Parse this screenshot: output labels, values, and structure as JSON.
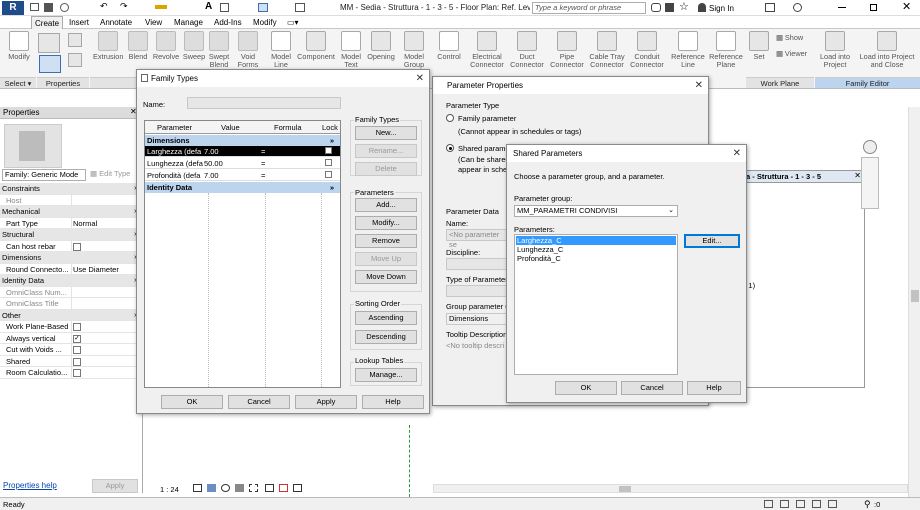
{
  "app": {
    "title": "MM - Sedia - Struttura - 1 - 3 - 5 - Floor Plan: Ref. Level",
    "search_placeholder": "Type a keyword or phrase",
    "sign_in": "Sign In",
    "logo_letter": "R"
  },
  "tabs": [
    "Create",
    "Insert",
    "Annotate",
    "View",
    "Manage",
    "Add-Ins",
    "Modify"
  ],
  "ribbon": {
    "buttons": [
      "Modify",
      "Extrusion",
      "Blend",
      "Revolve",
      "Sweep",
      "Swept Blend",
      "Void Forms",
      "Model Line",
      "Component",
      "Model Text",
      "Opening",
      "Model Group",
      "Control",
      "Electrical Connector",
      "Duct Connector",
      "Pipe Connector",
      "Cable Tray Connector",
      "Conduit Connector",
      "Reference Line",
      "Reference Plane",
      "Set",
      "Show",
      "Viewer",
      "Load into Project",
      "Load into Project and Close"
    ],
    "panels": {
      "select": "Select ▾",
      "properties": "Properties",
      "work_plane": "Work Plane",
      "family_editor": "Family Editor"
    }
  },
  "properties_panel": {
    "title": "Properties",
    "family_selector": "Family: Generic Mode",
    "edit_type": "Edit Type",
    "rows": [
      {
        "cat": true,
        "k": "Constraints"
      },
      {
        "k": "Host",
        "v": "",
        "dim": true
      },
      {
        "cat": true,
        "k": "Mechanical"
      },
      {
        "k": "Part Type",
        "v": "Normal"
      },
      {
        "cat": true,
        "k": "Structural"
      },
      {
        "k": "Can host rebar",
        "cb": ""
      },
      {
        "cat": true,
        "k": "Dimensions"
      },
      {
        "k": "Round Connecto...",
        "v": "Use Diameter"
      },
      {
        "cat": true,
        "k": "Identity Data"
      },
      {
        "k": "OmniClass Num...",
        "v": "",
        "dim": true
      },
      {
        "k": "OmniClass Title",
        "v": "",
        "dim": true
      },
      {
        "cat": true,
        "k": "Other"
      },
      {
        "k": "Work Plane-Based",
        "cb": ""
      },
      {
        "k": "Always vertical",
        "cb": "✓"
      },
      {
        "k": "Cut with Voids ...",
        "cb": ""
      },
      {
        "k": "Shared",
        "cb": ""
      },
      {
        "k": "Room Calculatio...",
        "cb": ""
      }
    ],
    "help_link": "Properties help",
    "apply": "Apply"
  },
  "family_types": {
    "title": "Family Types",
    "name_label": "Name:",
    "columns": [
      "Parameter",
      "Value",
      "Formula",
      "Lock"
    ],
    "sections": {
      "dimensions": "Dimensions",
      "identity": "Identity Data"
    },
    "rows": [
      {
        "param": "Larghezza (defa",
        "value": "7.00",
        "formula": "="
      },
      {
        "param": "Lunghezza (defa",
        "value": "50.00",
        "formula": "="
      },
      {
        "param": "Profondità (defa",
        "value": "7.00",
        "formula": "="
      }
    ],
    "groups": {
      "family_types": "Family Types",
      "parameters": "Parameters",
      "sorting": "Sorting Order",
      "lookup": "Lookup Tables"
    },
    "buttons": {
      "new": "New...",
      "rename": "Rename...",
      "delete": "Delete",
      "add": "Add...",
      "modify": "Modify...",
      "remove": "Remove",
      "move_up": "Move Up",
      "move_down": "Move Down",
      "ascending": "Ascending",
      "descending": "Descending",
      "manage": "Manage...",
      "ok": "OK",
      "cancel": "Cancel",
      "apply": "Apply",
      "help": "Help"
    }
  },
  "parameter_properties": {
    "title": "Parameter Properties",
    "param_type": "Parameter Type",
    "family_param": "Family parameter",
    "family_param_note": "(Cannot appear in schedules or tags)",
    "shared_param": "Shared paramet",
    "shared_note_1": "(Can be shared",
    "shared_note_2": "appear in sched",
    "param_data": "Parameter Data",
    "name_label": "Name:",
    "name_placeholder": "<No parameter se",
    "discipline": "Discipline:",
    "type_of_param": "Type of Parameter:",
    "group_param": "Group parameter u",
    "group_value": "Dimensions",
    "tooltip_label": "Tooltip Description:",
    "tooltip_placeholder": "<No tooltip descri"
  },
  "shared_parameters": {
    "title": "Shared Parameters",
    "instruction": "Choose a parameter group, and a parameter.",
    "group_label": "Parameter group:",
    "group_value": "MM_PARAMETRI CONDIVISI",
    "params_label": "Parameters:",
    "params": [
      "Larghezza_C",
      "Lunghezza_C",
      "Profondità_C"
    ],
    "edit": "Edit...",
    "ok": "OK",
    "cancel": "Cancel",
    "help": "Help"
  },
  "background_view": {
    "title": "a - Struttura - 1 - 3 - 5",
    "text_fragment": "on 1)",
    "scale": "1 : 24"
  },
  "status": {
    "text": "Ready",
    "filter_count": ":0"
  }
}
